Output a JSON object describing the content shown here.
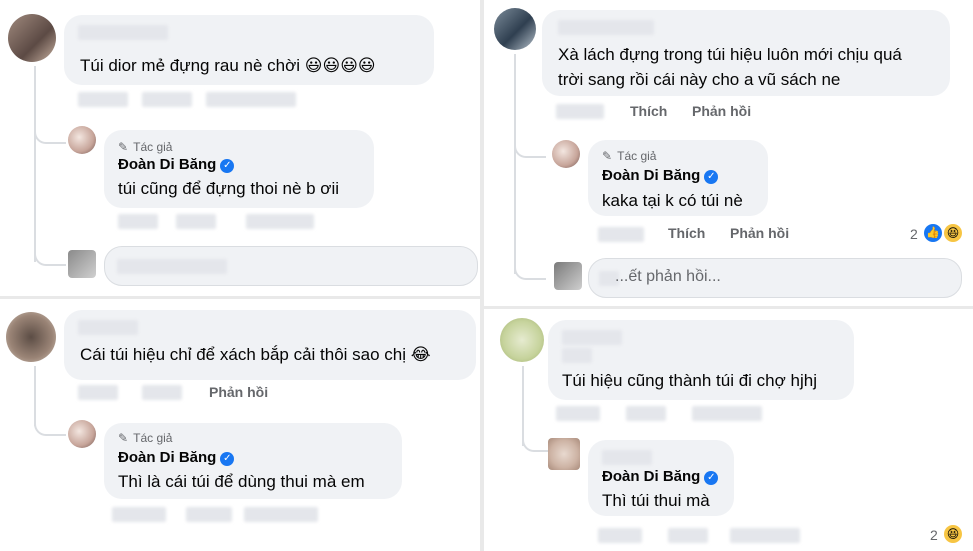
{
  "left": {
    "c1": {
      "text": "Túi dior mẻ đựng rau nè chời 😃😃😃😃",
      "reply": {
        "author_badge": "Tác giả",
        "name": "Đoàn Di Băng",
        "text": "túi cũng để đựng thoi nè b ơii"
      }
    },
    "c2": {
      "text": "Cái túi hiệu chỉ để xách bắp cải thôi sao chị 😂",
      "actions": {
        "reply": "Phản hồi"
      },
      "reply": {
        "author_badge": "Tác giả",
        "name": "Đoàn Di Băng",
        "text": "Thì là cái túi để dùng thui mà em"
      }
    }
  },
  "right": {
    "c1": {
      "text_line1": "Xà lách đựng trong túi hiệu luôn mới chịu quá",
      "text_line2": "trời sang rồi cái này cho a vũ sách ne",
      "actions": {
        "like": "Thích",
        "reply": "Phản hồi"
      },
      "reply": {
        "author_badge": "Tác giả",
        "name": "Đoàn Di Băng",
        "text": "kaka tại k có túi nè",
        "actions": {
          "like": "Thích",
          "reply": "Phản hồi"
        },
        "reactions_count": "2"
      },
      "input_placeholder": "...ết phản hồi..."
    },
    "c2": {
      "text": "Túi hiệu cũng thành túi đi chợ hjhj",
      "reply": {
        "name": "Đoàn Di Băng",
        "text": "Thì túi thui mà",
        "reactions_count": "2"
      }
    }
  },
  "icons": {
    "verified": "verified-check-icon",
    "pen": "pen-icon",
    "like": "like-reaction-icon",
    "haha": "haha-reaction-icon"
  },
  "colors": {
    "bubble": "#f0f2f5",
    "verified": "#1877f2",
    "muted": "#65676b"
  }
}
